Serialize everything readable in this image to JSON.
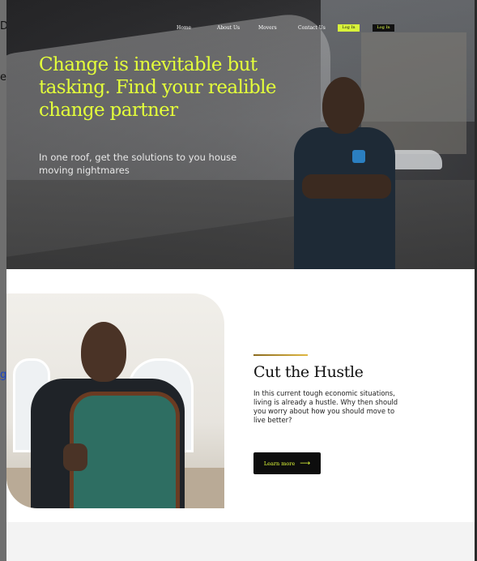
{
  "brand": {
    "accent": "#e4ff3a",
    "dark": "#0d0d0d"
  },
  "outer": {
    "fragment_c": "D",
    "fragment_e": "e",
    "fragment_g": "g"
  },
  "nav": {
    "items": [
      {
        "label": "Home"
      },
      {
        "label": "About Us"
      },
      {
        "label": "Movers"
      },
      {
        "label": "Contact Us"
      }
    ],
    "login_primary": "Log In",
    "login_secondary": "Log In"
  },
  "hero": {
    "title": "Change is inevitable but tasking. Find your realible change partner",
    "subtitle": "In one roof, get the solutions to you house moving nightmares"
  },
  "feature": {
    "title": "Cut the Hustle",
    "body": "In this current tough economic situations, living is already a hustle. Why then should you worry about how you should move to live better?",
    "cta_label": "Learn more",
    "cta_icon": "arrow-right-icon"
  }
}
